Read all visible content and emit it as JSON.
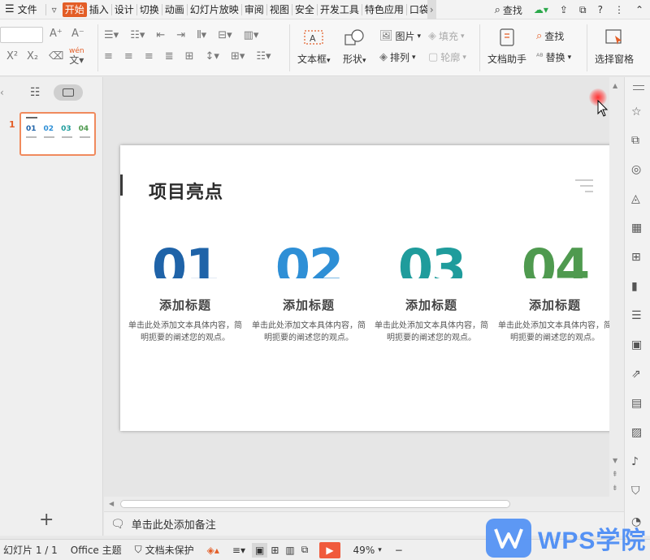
{
  "menu": {
    "file": "文件",
    "tabs": [
      "开始",
      "插入",
      "设计",
      "切换",
      "动画",
      "幻灯片放映",
      "审阅",
      "视图",
      "安全",
      "开发工具",
      "特色应用",
      "口袋"
    ],
    "active_tab": "开始",
    "search": "查找"
  },
  "ribbon": {
    "textbox": "文本框",
    "shape": "形状",
    "picture": "图片",
    "fill": "填充",
    "arrange": "排列",
    "outline": "轮廓",
    "doc_assistant": "文档助手",
    "find": "查找",
    "replace": "替换",
    "selection_pane": "选择窗格",
    "superscript": "X²",
    "subscript": "X₂",
    "font_grow": "A⁺",
    "font_shrink": "A⁻",
    "wen": "wén"
  },
  "slides_panel": {
    "slide_number": "1",
    "add_slide": "+"
  },
  "slide": {
    "title": "项目亮点",
    "columns": [
      {
        "number": "01",
        "color": "#1f63a8",
        "heading": "添加标题",
        "body": "单击此处添加文本具体内容，简明扼要的阐述您的观点。"
      },
      {
        "number": "02",
        "color": "#2e8fd6",
        "heading": "添加标题",
        "body": "单击此处添加文本具体内容，简明扼要的阐述您的观点。"
      },
      {
        "number": "03",
        "color": "#1f9c9c",
        "heading": "添加标题",
        "body": "单击此处添加文本具体内容，简明扼要的阐述您的观点。"
      },
      {
        "number": "04",
        "color": "#4f9a4f",
        "heading": "添加标题",
        "body": "单击此处添加文本具体内容，简明扼要的阐述您的观点。"
      }
    ]
  },
  "notes": {
    "placeholder": "单击此处添加备注"
  },
  "status": {
    "slide_count": "幻灯片 1 / 1",
    "theme": "Office 主题",
    "protect": "文档未保护",
    "zoom": "49%"
  },
  "watermark": {
    "text": "WPS学院"
  },
  "colors": {
    "accent": "#e35d26",
    "thumb_border": "#f08a5d"
  }
}
